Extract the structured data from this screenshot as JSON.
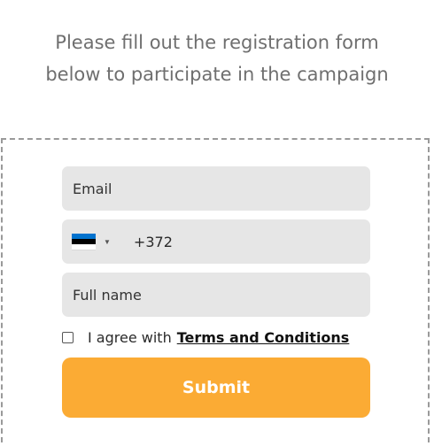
{
  "intro": {
    "text": "Please fill out the registration form below to participate in the campaign"
  },
  "form": {
    "email": {
      "placeholder": "Email",
      "value": ""
    },
    "phone": {
      "country_flag": "estonia-flag-icon",
      "dial_code": "+372"
    },
    "full_name": {
      "placeholder": "Full name",
      "value": ""
    },
    "consent": {
      "checked": false,
      "prefix": "I agree with",
      "link_text": "Terms and Conditions"
    },
    "submit_label": "Submit"
  },
  "colors": {
    "field_background": "#e6e6e6",
    "submit_background": "#fbab34",
    "submit_text": "#ffffff",
    "intro_text": "#6f6f6f",
    "flag_blue": "#0072ce",
    "flag_black": "#000000",
    "flag_white": "#ffffff"
  }
}
